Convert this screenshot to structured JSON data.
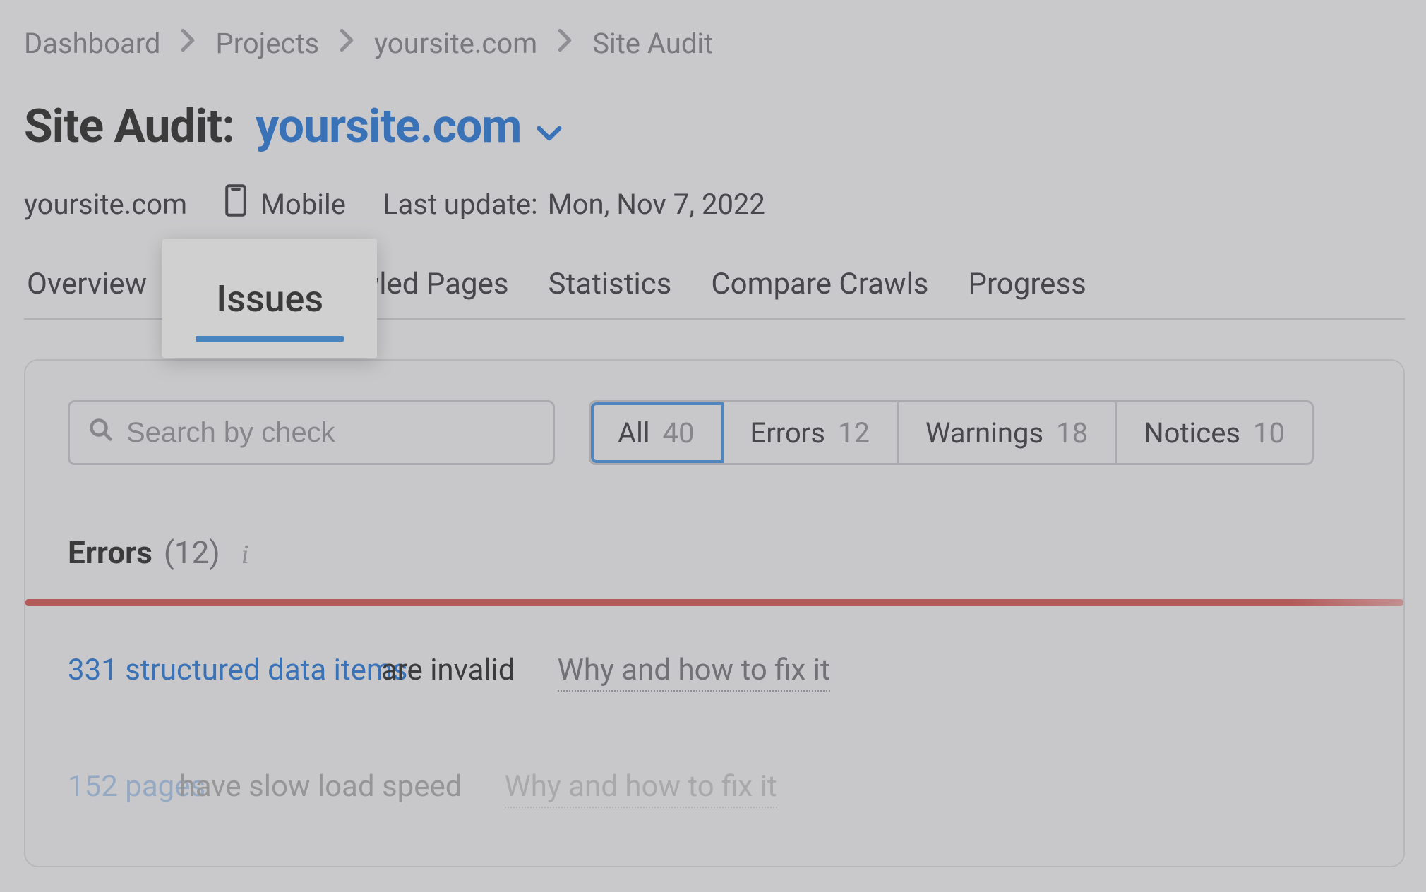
{
  "breadcrumb": {
    "items": [
      "Dashboard",
      "Projects",
      "yoursite.com",
      "Site Audit"
    ]
  },
  "title": {
    "label": "Site Audit:",
    "domain": "yoursite.com"
  },
  "meta": {
    "domain": "yoursite.com",
    "device": "Mobile",
    "last_update_label": "Last update:",
    "last_update_value": "Mon, Nov 7, 2022"
  },
  "tabs": {
    "overview": "Overview",
    "issues": "Issues",
    "crawled": "Crawled Pages",
    "statistics": "Statistics",
    "compare": "Compare Crawls",
    "progress": "Progress"
  },
  "search": {
    "placeholder": "Search by check"
  },
  "filters": {
    "all_label": "All",
    "all_count": "40",
    "errors_label": "Errors",
    "errors_count": "12",
    "warnings_label": "Warnings",
    "warnings_count": "18",
    "notices_label": "Notices",
    "notices_count": "10"
  },
  "errors_section": {
    "label": "Errors",
    "count": "(12)"
  },
  "issues": [
    {
      "link": "331 structured data items",
      "text": " are invalid",
      "fix": "Why and how to fix it"
    },
    {
      "link": "152 pages",
      "text": " have slow load speed",
      "fix": "Why and how to fix it"
    }
  ]
}
